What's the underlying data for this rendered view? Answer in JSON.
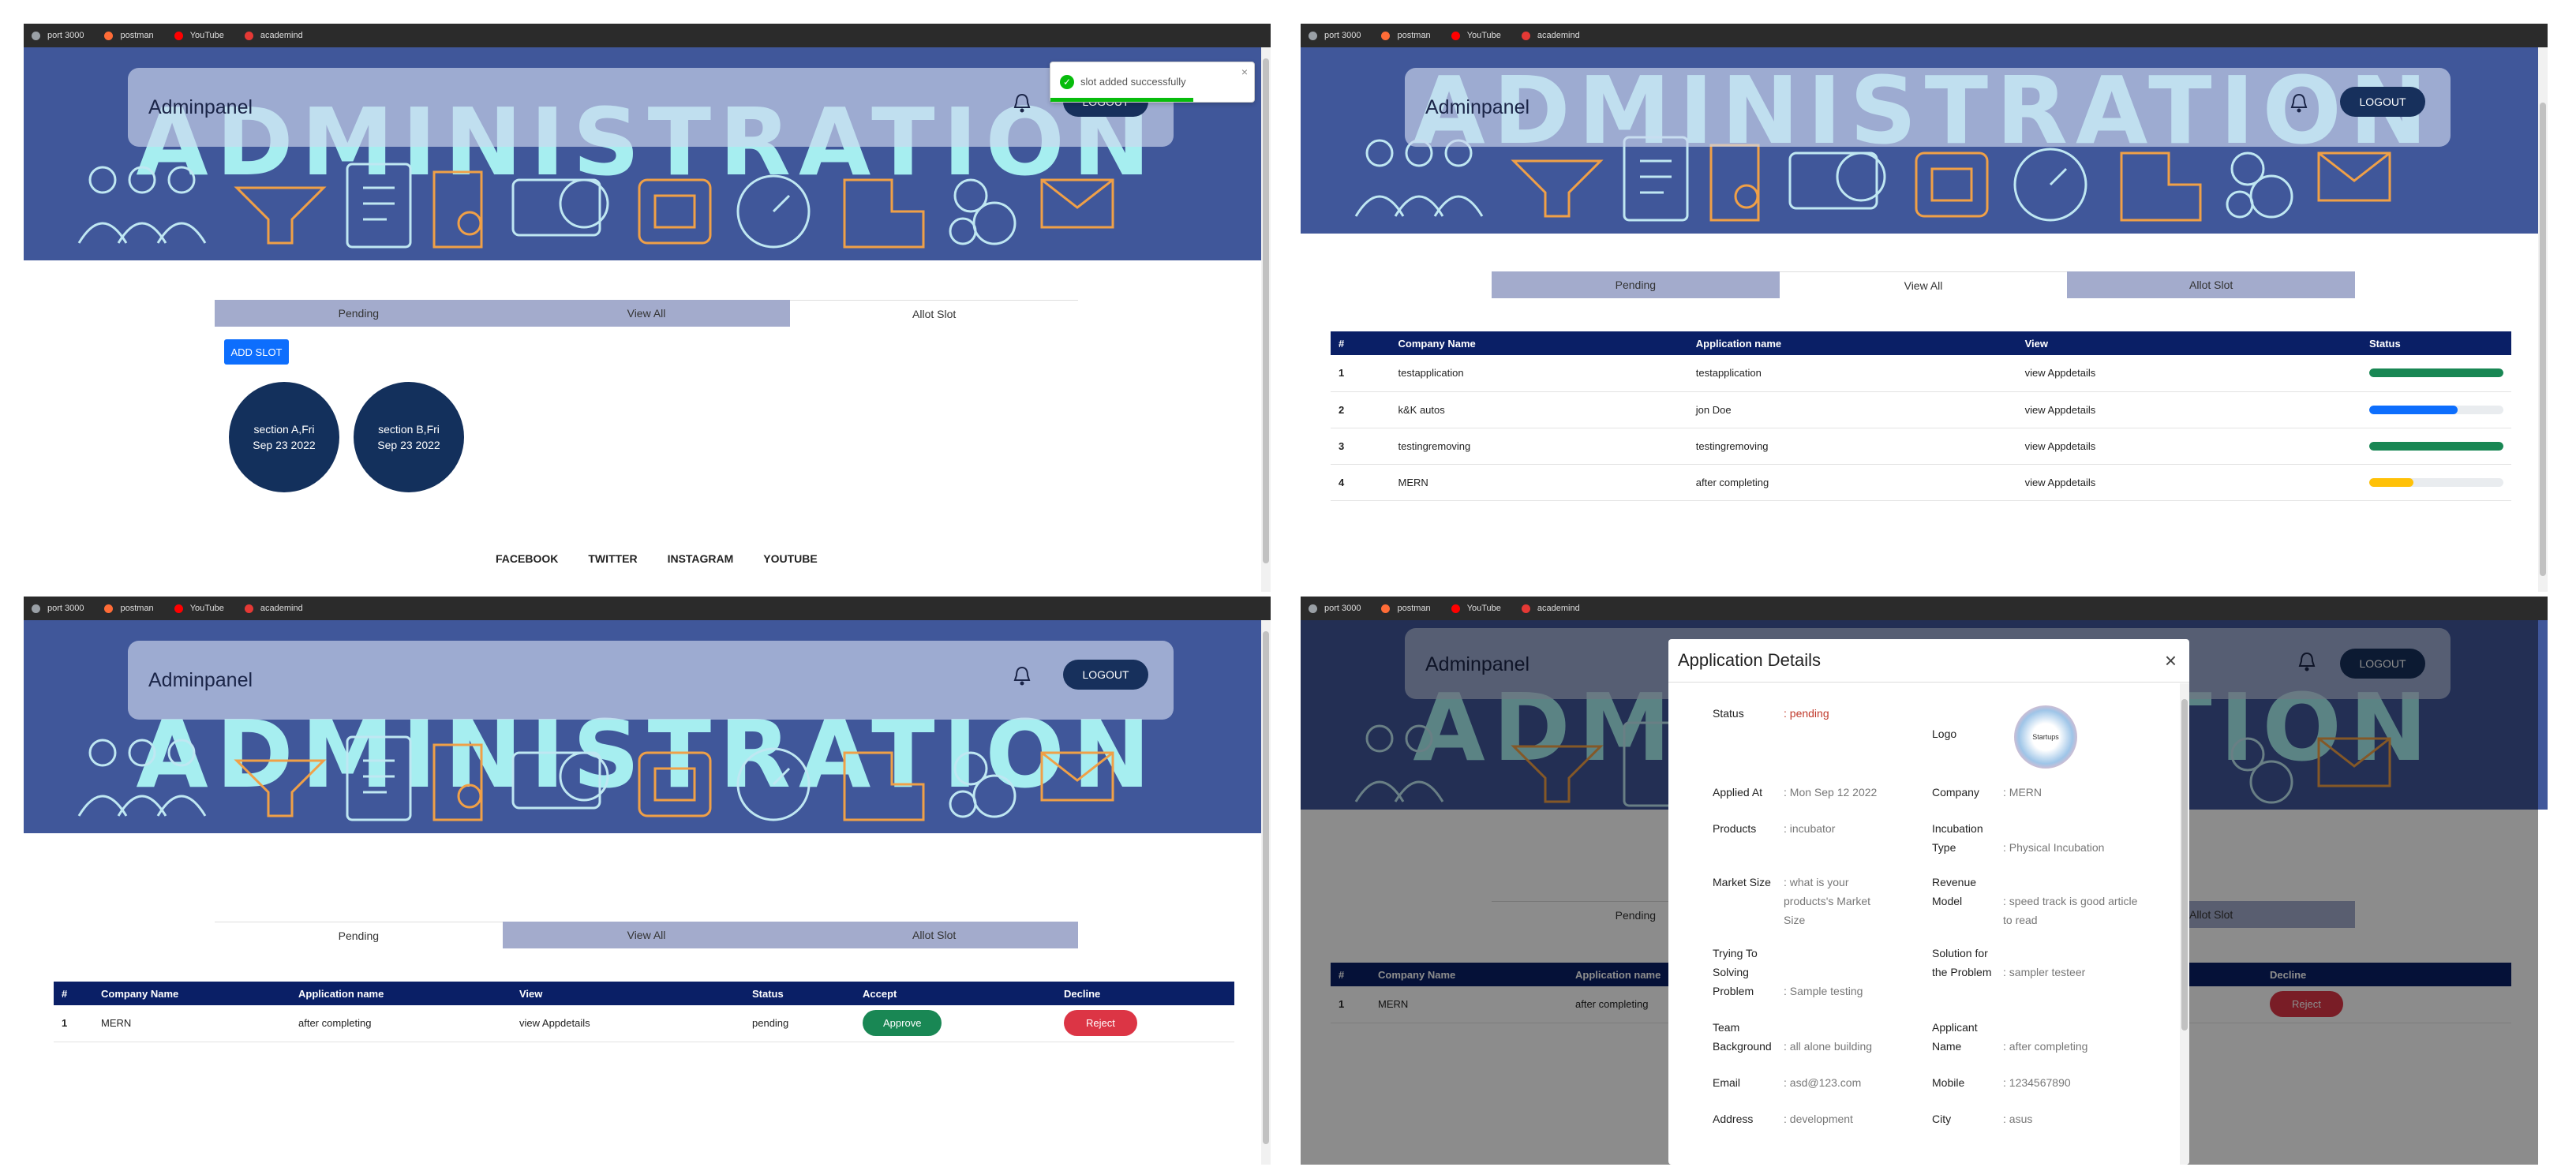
{
  "bookmarks": [
    {
      "label": "port 3000",
      "icon": "globe-icon",
      "color": "#9aa0a6"
    },
    {
      "label": "postman",
      "icon": "postman-icon",
      "color": "#ff6c37"
    },
    {
      "label": "YouTube",
      "icon": "youtube-icon",
      "color": "#ff0000"
    },
    {
      "label": "academind",
      "icon": "academind-icon",
      "color": "#e53935"
    }
  ],
  "header": {
    "brand": "Adminpanel",
    "logout": "LOGOUT",
    "banner_word": "ADMINISTRATION"
  },
  "tabs": [
    "Pending",
    "View All",
    "Allot Slot"
  ],
  "toast": {
    "message": "slot added successfully",
    "close": "×"
  },
  "allot_slot": {
    "add_button": "ADD SLOT",
    "slots": [
      {
        "line1": "section A,Fri",
        "line2": "Sep 23 2022"
      },
      {
        "line1": "section B,Fri",
        "line2": "Sep 23 2022"
      }
    ]
  },
  "footer": [
    "FACEBOOK",
    "TWITTER",
    "INSTAGRAM",
    "YOUTUBE"
  ],
  "view_all": {
    "headers": [
      "#",
      "Company Name",
      "Application name",
      "View",
      "Status"
    ],
    "rows": [
      {
        "n": "1",
        "company": "testapplication",
        "app": "testapplication",
        "view": "view Appdetails",
        "progress": 1.0,
        "color": "#198754"
      },
      {
        "n": "2",
        "company": "k&K autos",
        "app": "jon Doe",
        "view": "view Appdetails",
        "progress": 0.66,
        "color": "#0d6efd"
      },
      {
        "n": "3",
        "company": "testingremoving",
        "app": "testingremoving",
        "view": "view Appdetails",
        "progress": 1.0,
        "color": "#198754"
      },
      {
        "n": "4",
        "company": "MERN",
        "app": "after completing",
        "view": "view Appdetails",
        "progress": 0.33,
        "color": "#ffc107"
      }
    ]
  },
  "pending": {
    "headers": [
      "#",
      "Company Name",
      "Application name",
      "View",
      "Status",
      "Accept",
      "Decline"
    ],
    "rows": [
      {
        "n": "1",
        "company": "MERN",
        "app": "after completing",
        "view": "view Appdetails",
        "status": "pending",
        "accept": "Approve",
        "decline": "Reject"
      }
    ]
  },
  "modal_bg": {
    "headers": [
      "#",
      "Company Name",
      "Application name",
      "Decline"
    ],
    "row": {
      "n": "1",
      "company": "MERN",
      "app": "after completing",
      "decline": "Reject"
    },
    "tabs": [
      "Pending",
      "Allot Slot"
    ]
  },
  "modal": {
    "title": "Application Details",
    "close": "×",
    "left": [
      {
        "label": "Status",
        "value": "pending"
      },
      {
        "label": "Applied At",
        "value": "Mon Sep 12 2022"
      },
      {
        "label": "Products",
        "value": "incubator"
      },
      {
        "label": "Market Size",
        "value": "what is your products's Market Size"
      },
      {
        "label": "Trying To Solving Problem",
        "value": "Sample testing"
      },
      {
        "label": "Team Background",
        "value": "all alone building"
      },
      {
        "label": "Email",
        "value": "asd@123.com"
      },
      {
        "label": "Address",
        "value": "development"
      }
    ],
    "right": [
      {
        "label": "Logo",
        "value": ""
      },
      {
        "label": "Company",
        "value": "MERN"
      },
      {
        "label": "Incubation Type",
        "value": "Physical Incubation"
      },
      {
        "label": "Revenue Model",
        "value": "speed track is good article to read"
      },
      {
        "label": "Solution for the Problem",
        "value": "sampler testeer"
      },
      {
        "label": "Applicant Name",
        "value": "after completing"
      },
      {
        "label": "Mobile",
        "value": "1234567890"
      },
      {
        "label": "City",
        "value": "asus"
      }
    ],
    "logo_text": "Startups"
  }
}
